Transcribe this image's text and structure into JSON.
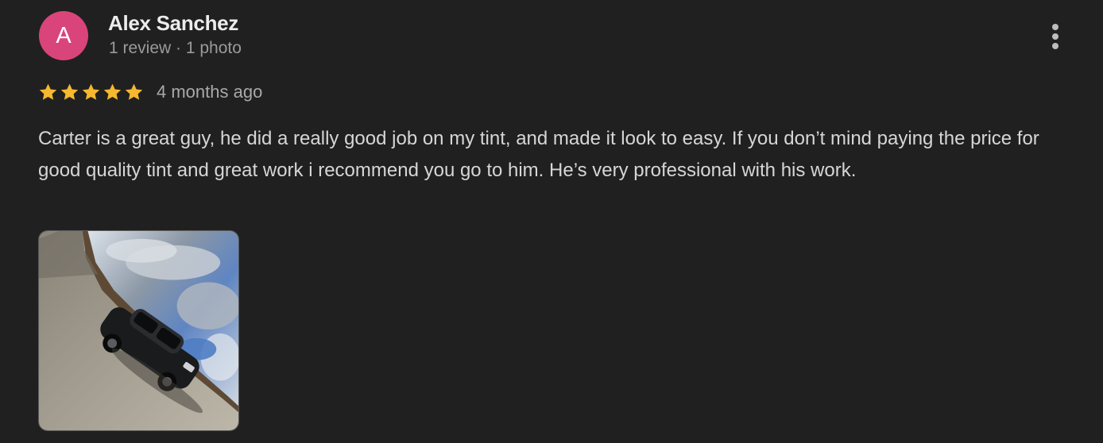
{
  "reviewer": {
    "initial": "A",
    "name": "Alex Sanchez",
    "meta": "1 review · 1 photo",
    "avatar_color": "#d9457a"
  },
  "review": {
    "rating": 5,
    "max_rating": 5,
    "date": "4 months ago",
    "text": "Carter is a great guy, he did a really good job on my tint, and made it look to easy. If you don’t mind paying the price for good quality tint and great work i recommend you go to him. He’s very professional with his work."
  },
  "icons": {
    "more": "more-vert-icon",
    "star": "star-icon"
  },
  "colors": {
    "background": "#202020",
    "star": "#f5b82e",
    "text": "#d6d6d6",
    "muted": "#9a9a9a"
  }
}
